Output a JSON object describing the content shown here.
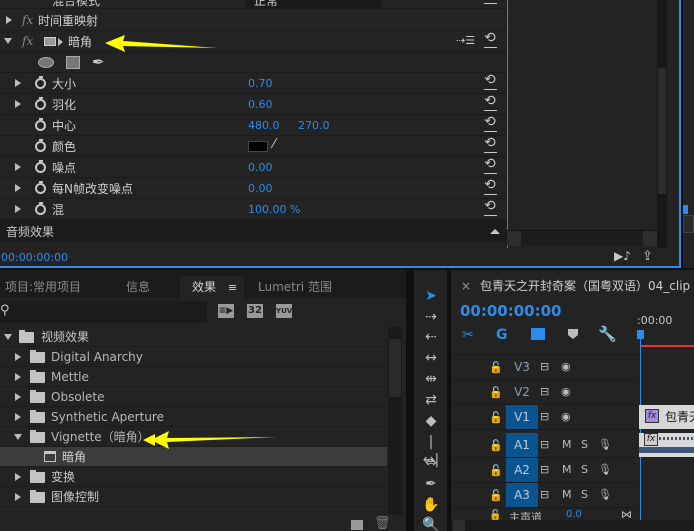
{
  "effect_controls": {
    "blend_mode_label": "混合模式",
    "blend_mode_value": "正常",
    "rows": [
      {
        "label": "时间重映射",
        "kind": "fx-collapsed"
      },
      {
        "label": "暗角",
        "kind": "fx-expanded"
      },
      {
        "label": "大小",
        "value1": "0.70"
      },
      {
        "label": "羽化",
        "value1": "0.60"
      },
      {
        "label": "中心",
        "value1": "480.0",
        "value2": "270.0"
      },
      {
        "label": "颜色",
        "color": "#000000"
      },
      {
        "label": "噪点",
        "value1": "0.00"
      },
      {
        "label": "每N帧改变噪点",
        "value1": "0.00"
      },
      {
        "label": "混",
        "value1": "100.00 %"
      }
    ],
    "audio_section": "音频效果",
    "timecode": "00:00:00:00"
  },
  "effects_panel": {
    "tabs": [
      {
        "label": "项目:常用项目",
        "active": false
      },
      {
        "label": "信息",
        "active": false
      },
      {
        "label": "效果",
        "active": true
      },
      {
        "label": "Lumetri 范围",
        "active": false
      }
    ],
    "menu_icon": "≡",
    "search_value": "",
    "filter_badges": [
      "accelerated-icon",
      "32",
      "YUV"
    ],
    "tree": [
      {
        "label": "视频效果",
        "level": 0,
        "expanded": true
      },
      {
        "label": "Digital Anarchy",
        "level": 1,
        "expanded": false
      },
      {
        "label": "Mettle",
        "level": 1,
        "expanded": false
      },
      {
        "label": "Obsolete",
        "level": 1,
        "expanded": false
      },
      {
        "label": "Synthetic Aperture",
        "level": 1,
        "expanded": false
      },
      {
        "label": "Vignette（暗角）",
        "level": 1,
        "expanded": true
      },
      {
        "label": "暗角",
        "level": 2,
        "selected": true
      },
      {
        "label": "变换",
        "level": 1,
        "expanded": false
      },
      {
        "label": "图像控制",
        "level": 1,
        "expanded": false
      }
    ]
  },
  "timeline": {
    "close_label": "×",
    "title": "包青天之开封奇案（国粤双语）04_clip",
    "timecode": "00:00:00:00",
    "ruler_label": ":00:00",
    "tracks": [
      {
        "name": "V3",
        "type": "video",
        "active": false
      },
      {
        "name": "V2",
        "type": "video",
        "active": false
      },
      {
        "name": "V1",
        "type": "video",
        "active": true
      },
      {
        "name": "A1",
        "type": "audio",
        "active": true
      },
      {
        "name": "A2",
        "type": "audio",
        "active": true
      },
      {
        "name": "A3",
        "type": "audio",
        "active": true
      }
    ],
    "master_label": "主声道",
    "master_value": "0.0",
    "mute_label": "M",
    "solo_label": "S",
    "clip_label": "包青天",
    "fx_badge": "fx"
  },
  "colors": {
    "accent": "#2d8ceb",
    "track_active": "#0a5590",
    "playhead_bar": "#e8322a",
    "annotation_arrow": "#ffff00"
  }
}
